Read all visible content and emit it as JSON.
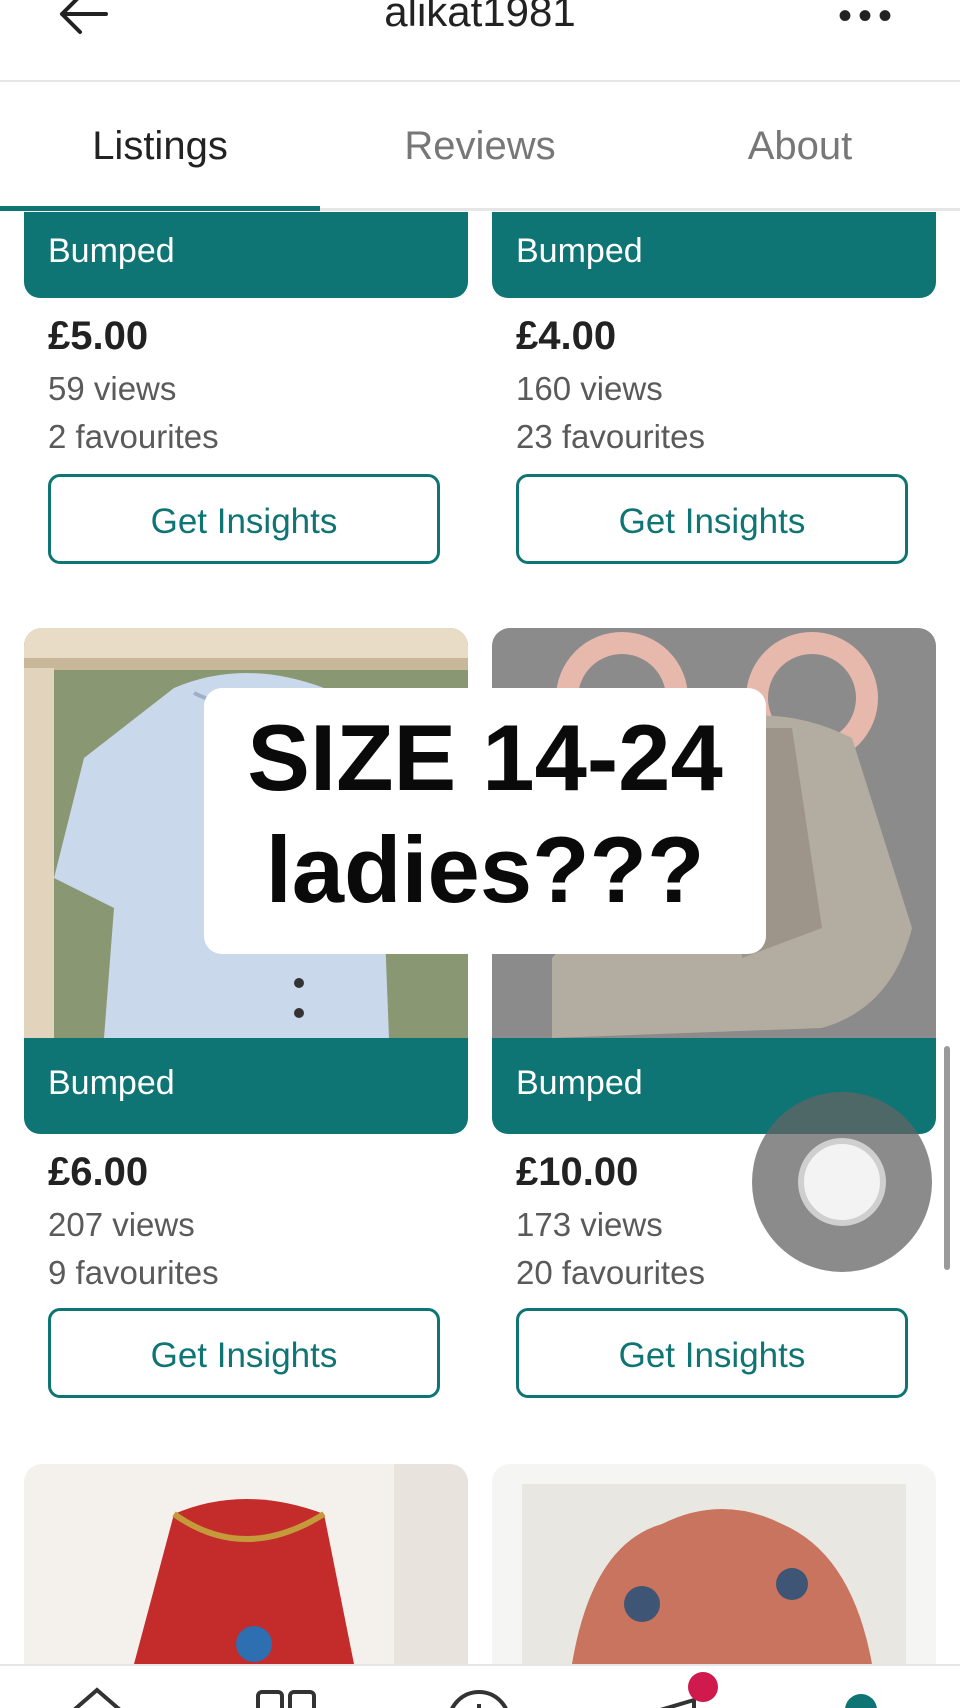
{
  "header": {
    "title": "alikat1981",
    "more_icon": "more-dots-icon",
    "back_icon": "back-arrow-icon"
  },
  "tabs": [
    {
      "label": "Listings",
      "active": true
    },
    {
      "label": "Reviews",
      "active": false
    },
    {
      "label": "About",
      "active": false
    }
  ],
  "listings": [
    {
      "badge": "Bumped",
      "price": "£5.00",
      "views": "59 views",
      "favourites": "2 favourites",
      "button": "Get Insights"
    },
    {
      "badge": "Bumped",
      "price": "£4.00",
      "views": "160 views",
      "favourites": "23 favourites",
      "button": "Get Insights"
    },
    {
      "badge": "Bumped",
      "price": "£6.00",
      "views": "207 views",
      "favourites": "9 favourites",
      "button": "Get Insights"
    },
    {
      "badge": "Bumped",
      "price": "£10.00",
      "views": "173 views",
      "favourites": "20 favourites",
      "button": "Get Insights"
    }
  ],
  "overlay": {
    "line1": "SIZE 14-24",
    "line2": "ladies???"
  },
  "colors": {
    "accent": "#0f7574",
    "notification": "#d01a4d"
  },
  "bottom_nav": [
    "home-icon",
    "browse-icon",
    "sell-icon",
    "inbox-icon",
    "profile-icon"
  ]
}
